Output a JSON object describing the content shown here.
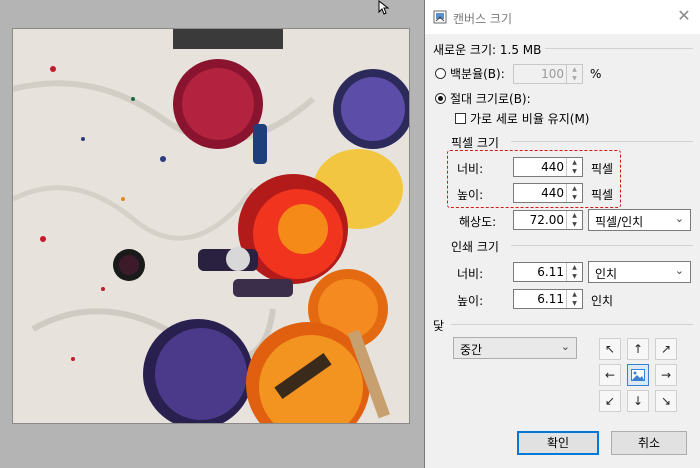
{
  "dialog": {
    "title": "캔버스 크기",
    "new_size_label": "새로운 크기: 1.5 MB",
    "by_percentage": {
      "label": "백분율(B):",
      "value": "100",
      "unit": "%",
      "selected": false
    },
    "by_absolute": {
      "label": "절대 크기로(B):",
      "selected": true
    },
    "keep_ratio": {
      "label": "가로 세로 비율 유지(M)",
      "checked": false
    },
    "pixel_size": {
      "heading": "픽셀 크기",
      "width_label": "너비:",
      "width_value": "440",
      "width_unit": "픽셀",
      "height_label": "높이:",
      "height_value": "440",
      "height_unit": "픽셀",
      "resolution_label": "해상도:",
      "resolution_value": "72.00",
      "resolution_unit": "픽셀/인치"
    },
    "print_size": {
      "heading": "인쇄 크기",
      "width_label": "너비:",
      "width_value": "6.11",
      "width_unit": "인치",
      "height_label": "높이:",
      "height_value": "6.11",
      "height_unit": "인치"
    },
    "anchor": {
      "heading": "닻",
      "selected": "중간",
      "arrows": [
        "↖",
        "↑",
        "↗",
        "←",
        "",
        "→",
        "↙",
        "↓",
        "↘"
      ]
    },
    "buttons": {
      "ok": "확인",
      "cancel": "취소"
    },
    "close_glyph": "✕"
  },
  "colors": {
    "highlight": "#d01818",
    "accent": "#0078d7"
  }
}
